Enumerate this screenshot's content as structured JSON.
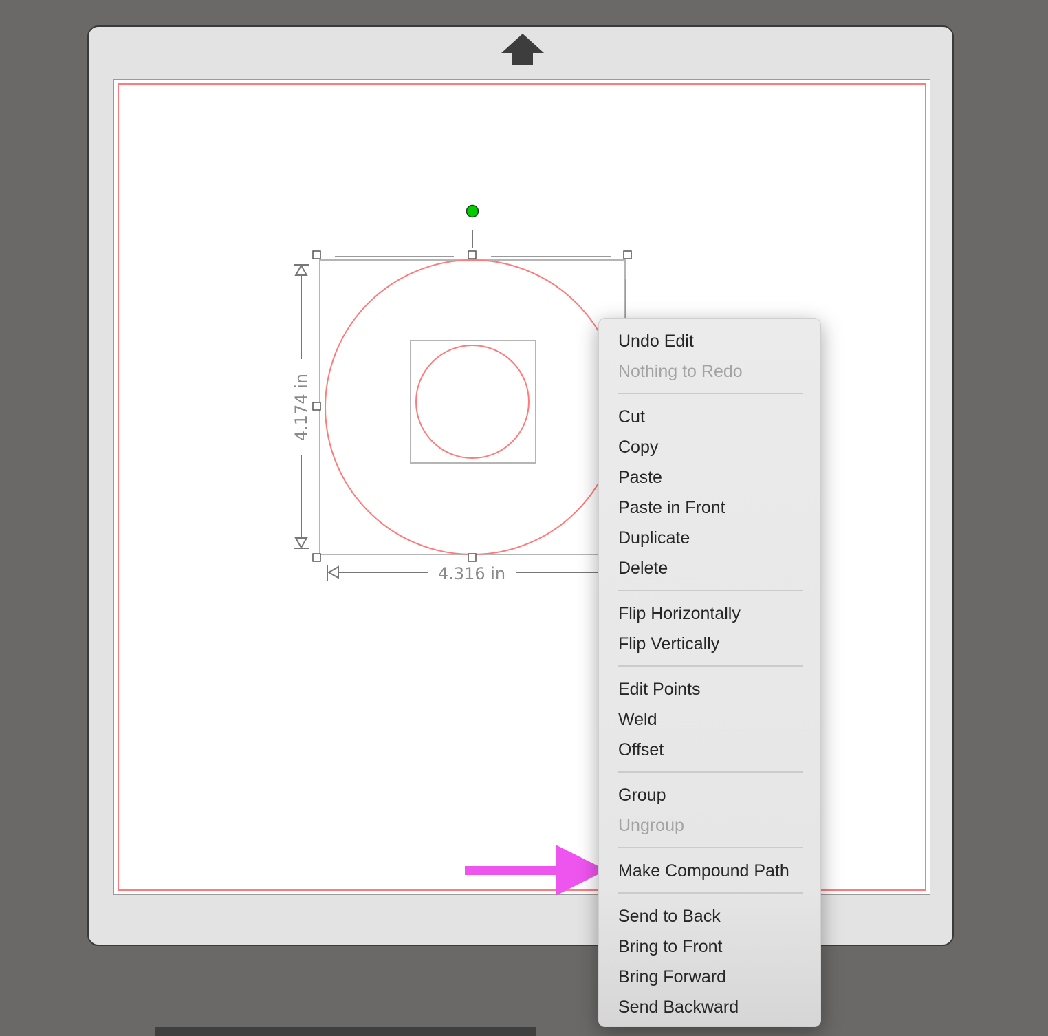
{
  "canvas": {
    "feed_icon": "up-arrow-icon",
    "width_label": "4.316 in",
    "height_label": "4.174 in"
  },
  "colors": {
    "background": "#6a6968",
    "mat_frame": "#e3e3e3",
    "cut_line": "#ff7a7a",
    "rotate_handle": "#00cc00",
    "annotation_arrow": "#ee55ee"
  },
  "context_menu": {
    "items": [
      {
        "label": "Undo Edit",
        "enabled": true
      },
      {
        "label": "Nothing to Redo",
        "enabled": false
      },
      {
        "label": "Cut",
        "enabled": true
      },
      {
        "label": "Copy",
        "enabled": true
      },
      {
        "label": "Paste",
        "enabled": true
      },
      {
        "label": "Paste in Front",
        "enabled": true
      },
      {
        "label": "Duplicate",
        "enabled": true
      },
      {
        "label": "Delete",
        "enabled": true
      },
      {
        "label": "Flip Horizontally",
        "enabled": true
      },
      {
        "label": "Flip Vertically",
        "enabled": true
      },
      {
        "label": "Edit Points",
        "enabled": true
      },
      {
        "label": "Weld",
        "enabled": true
      },
      {
        "label": "Offset",
        "enabled": true
      },
      {
        "label": "Group",
        "enabled": true
      },
      {
        "label": "Ungroup",
        "enabled": false
      },
      {
        "label": "Make Compound Path",
        "enabled": true
      },
      {
        "label": "Send to Back",
        "enabled": true
      },
      {
        "label": "Bring to Front",
        "enabled": true
      },
      {
        "label": "Bring Forward",
        "enabled": true
      },
      {
        "label": "Send Backward",
        "enabled": true
      }
    ]
  }
}
